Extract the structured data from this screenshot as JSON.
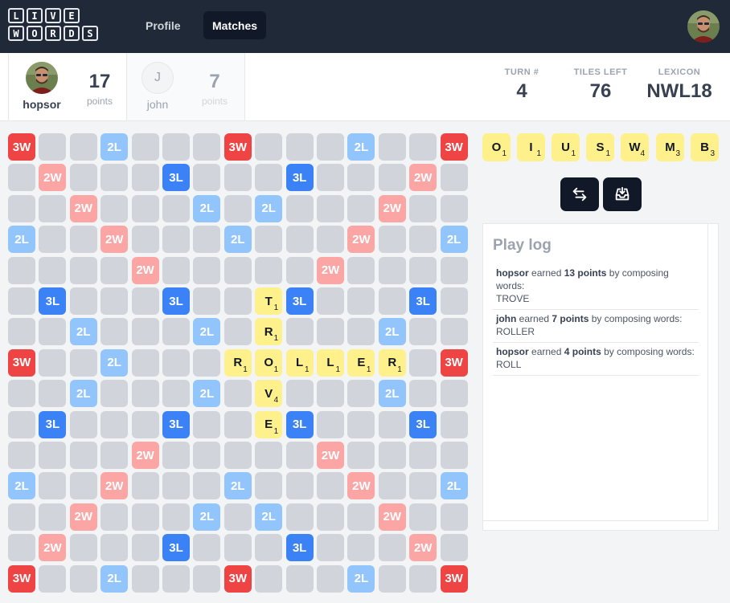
{
  "nav": {
    "logo_rows": [
      [
        "L",
        "I",
        "V",
        "E"
      ],
      [
        "W",
        "O",
        "R",
        "D",
        "S"
      ]
    ],
    "links": [
      {
        "label": "Profile",
        "active": false
      },
      {
        "label": "Matches",
        "active": true
      }
    ]
  },
  "players": [
    {
      "name": "hopsor",
      "score": "17",
      "score_label": "points",
      "active": true
    },
    {
      "name": "john",
      "initial": "J",
      "score": "7",
      "score_label": "points",
      "active": false
    }
  ],
  "stats": [
    {
      "label": "TURN #",
      "value": "4"
    },
    {
      "label": "TILES LEFT",
      "value": "76"
    },
    {
      "label": "LEXICON",
      "value": "NWL18"
    }
  ],
  "board": {
    "premium": {
      "3W": [
        [
          0,
          0
        ],
        [
          0,
          7
        ],
        [
          0,
          14
        ],
        [
          7,
          0
        ],
        [
          7,
          14
        ],
        [
          14,
          0
        ],
        [
          14,
          7
        ],
        [
          14,
          14
        ]
      ],
      "2W": [
        [
          1,
          1
        ],
        [
          1,
          13
        ],
        [
          2,
          2
        ],
        [
          2,
          12
        ],
        [
          3,
          3
        ],
        [
          3,
          11
        ],
        [
          4,
          4
        ],
        [
          4,
          10
        ],
        [
          10,
          4
        ],
        [
          10,
          10
        ],
        [
          11,
          3
        ],
        [
          11,
          11
        ],
        [
          12,
          2
        ],
        [
          12,
          12
        ],
        [
          13,
          1
        ],
        [
          13,
          13
        ]
      ],
      "3L": [
        [
          1,
          5
        ],
        [
          1,
          9
        ],
        [
          5,
          1
        ],
        [
          5,
          5
        ],
        [
          5,
          9
        ],
        [
          5,
          13
        ],
        [
          9,
          1
        ],
        [
          9,
          5
        ],
        [
          9,
          9
        ],
        [
          9,
          13
        ],
        [
          13,
          5
        ],
        [
          13,
          9
        ]
      ],
      "2L": [
        [
          0,
          3
        ],
        [
          0,
          11
        ],
        [
          2,
          6
        ],
        [
          2,
          8
        ],
        [
          3,
          0
        ],
        [
          3,
          7
        ],
        [
          3,
          14
        ],
        [
          6,
          2
        ],
        [
          6,
          6
        ],
        [
          6,
          12
        ],
        [
          7,
          3
        ],
        [
          7,
          11
        ],
        [
          8,
          2
        ],
        [
          8,
          6
        ],
        [
          8,
          12
        ],
        [
          11,
          0
        ],
        [
          11,
          7
        ],
        [
          11,
          14
        ],
        [
          12,
          6
        ],
        [
          12,
          8
        ],
        [
          14,
          3
        ],
        [
          14,
          11
        ]
      ]
    },
    "tiles": [
      {
        "row": 5,
        "col": 8,
        "letter": "T",
        "value": "1"
      },
      {
        "row": 6,
        "col": 8,
        "letter": "R",
        "value": "1"
      },
      {
        "row": 7,
        "col": 7,
        "letter": "R",
        "value": "1"
      },
      {
        "row": 7,
        "col": 8,
        "letter": "O",
        "value": "1"
      },
      {
        "row": 7,
        "col": 9,
        "letter": "L",
        "value": "1"
      },
      {
        "row": 7,
        "col": 10,
        "letter": "L",
        "value": "1"
      },
      {
        "row": 7,
        "col": 11,
        "letter": "E",
        "value": "1"
      },
      {
        "row": 7,
        "col": 12,
        "letter": "R",
        "value": "1"
      },
      {
        "row": 8,
        "col": 8,
        "letter": "V",
        "value": "4"
      },
      {
        "row": 9,
        "col": 8,
        "letter": "E",
        "value": "1"
      }
    ]
  },
  "rack": [
    {
      "letter": "O",
      "value": "1"
    },
    {
      "letter": "I",
      "value": "1"
    },
    {
      "letter": "U",
      "value": "1"
    },
    {
      "letter": "S",
      "value": "1"
    },
    {
      "letter": "W",
      "value": "4"
    },
    {
      "letter": "M",
      "value": "3"
    },
    {
      "letter": "B",
      "value": "3"
    }
  ],
  "actions": [
    {
      "icon": "swap-arrows-icon"
    },
    {
      "icon": "inbox-download-icon"
    }
  ],
  "log": {
    "title": "Play log",
    "entries": [
      {
        "player": "hopsor",
        "earned": "earned",
        "points": "13 points",
        "rest": "by composing words:",
        "words": "TROVE"
      },
      {
        "player": "john",
        "earned": "earned",
        "points": "7 points",
        "rest": "by composing words:",
        "words": "ROLLER"
      },
      {
        "player": "hopsor",
        "earned": "earned",
        "points": "4 points",
        "rest": "by composing words:",
        "words": "ROLL"
      }
    ]
  }
}
